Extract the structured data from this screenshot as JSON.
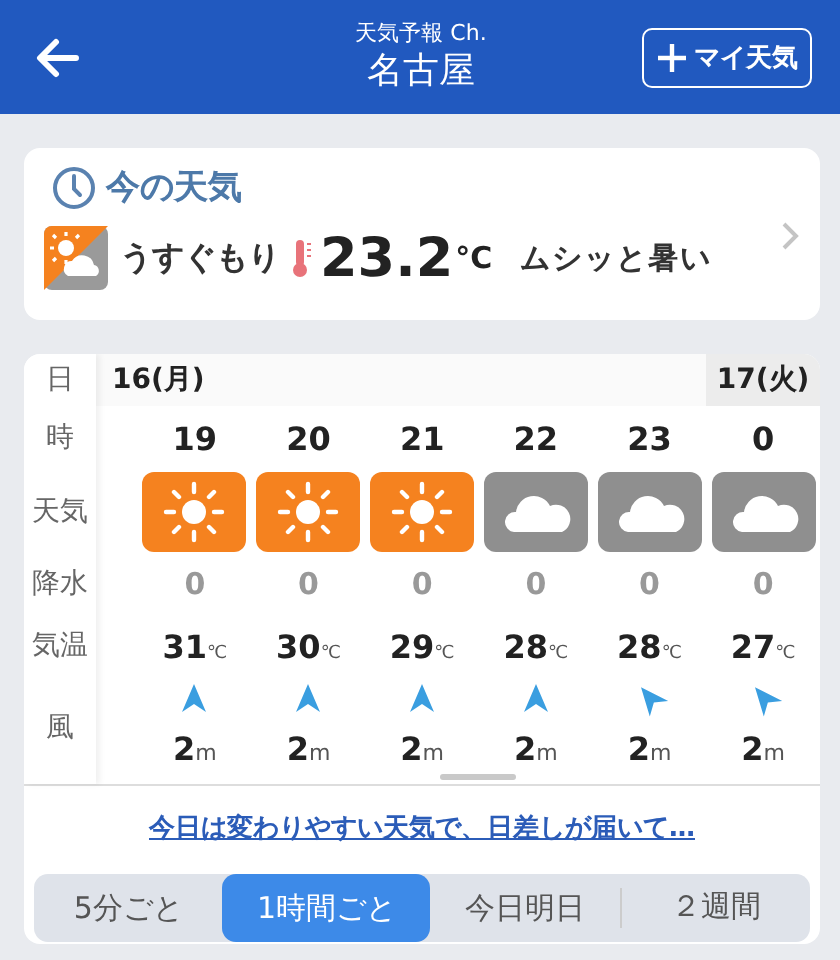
{
  "header": {
    "subtitle": "天気予報 Ch.",
    "title": "名古屋",
    "button": "マイ天気"
  },
  "current": {
    "heading": "今の天気",
    "icon": {
      "kind": "suncloud"
    },
    "condition": "うすぐもり",
    "temperature": "23.2",
    "unit": "°C",
    "feeling": "ムシッと暑い"
  },
  "forecast": {
    "row_labels": [
      "日",
      "時",
      "天気",
      "降水",
      "気温",
      "風"
    ],
    "dates": [
      {
        "label": "16(月)",
        "shaded": false
      },
      {
        "label": "17(火)",
        "shaded": true
      }
    ],
    "hours": [
      {
        "hour": "19",
        "icon": {
          "kind": "sunny"
        },
        "precipitation": "0",
        "temperature": "31",
        "temp_unit": "℃",
        "wind_arrow": {
          "kind": "north"
        },
        "wind": "2",
        "wind_unit": "m"
      },
      {
        "hour": "20",
        "icon": {
          "kind": "sunny"
        },
        "precipitation": "0",
        "temperature": "30",
        "temp_unit": "℃",
        "wind_arrow": {
          "kind": "north"
        },
        "wind": "2",
        "wind_unit": "m"
      },
      {
        "hour": "21",
        "icon": {
          "kind": "sunny"
        },
        "precipitation": "0",
        "temperature": "29",
        "temp_unit": "℃",
        "wind_arrow": {
          "kind": "north"
        },
        "wind": "2",
        "wind_unit": "m"
      },
      {
        "hour": "22",
        "icon": {
          "kind": "cloudy"
        },
        "precipitation": "0",
        "temperature": "28",
        "temp_unit": "℃",
        "wind_arrow": {
          "kind": "north"
        },
        "wind": "2",
        "wind_unit": "m"
      },
      {
        "hour": "23",
        "icon": {
          "kind": "cloudy"
        },
        "precipitation": "0",
        "temperature": "28",
        "temp_unit": "℃",
        "wind_arrow": {
          "kind": "northwest"
        },
        "wind": "2",
        "wind_unit": "m"
      },
      {
        "hour": "0",
        "icon": {
          "kind": "cloudy"
        },
        "precipitation": "0",
        "temperature": "27",
        "temp_unit": "℃",
        "wind_arrow": {
          "kind": "northwest"
        },
        "wind": "2",
        "wind_unit": "m"
      }
    ],
    "link": "今日は変わりやすい天気で、日差しが届いて…"
  },
  "tabs": [
    {
      "label": "5分ごと",
      "selected": false
    },
    {
      "label": "1時間ごと",
      "selected": true
    },
    {
      "label": "今日明日",
      "selected": false
    },
    {
      "label": "２週間",
      "selected": false
    }
  ]
}
